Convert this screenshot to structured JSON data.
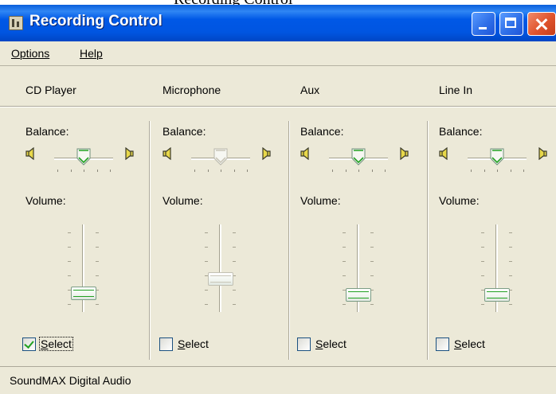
{
  "caption": "Recording Control (clipped)",
  "window": {
    "title": "Recording Control",
    "buttons": {
      "minimize": "minimize",
      "maximize": "maximize",
      "close": "close"
    }
  },
  "menu": [
    {
      "label": "Options"
    },
    {
      "label": "Help"
    }
  ],
  "labels": {
    "balance": "Balance:",
    "volume": "Volume:",
    "select_first": "S",
    "select_rest": "elect"
  },
  "columns": [
    {
      "name": "CD Player",
      "balance_pct": 50,
      "volume_pct": 22,
      "enabled": true,
      "selected": true
    },
    {
      "name": "Microphone",
      "balance_pct": 50,
      "volume_pct": 38,
      "enabled": false,
      "selected": false
    },
    {
      "name": "Aux",
      "balance_pct": 50,
      "volume_pct": 20,
      "enabled": true,
      "selected": false
    },
    {
      "name": "Line In",
      "balance_pct": 50,
      "volume_pct": 20,
      "enabled": true,
      "selected": false
    }
  ],
  "status": {
    "text": "SoundMAX Digital Audio"
  },
  "colors": {
    "titlebar": "#0058e6",
    "face": "#ece9d8",
    "accent_green": "#21a121"
  },
  "icons": {
    "app": "mixer-icon",
    "speaker_left": "speaker-left-icon",
    "speaker_right": "speaker-right-icon"
  }
}
